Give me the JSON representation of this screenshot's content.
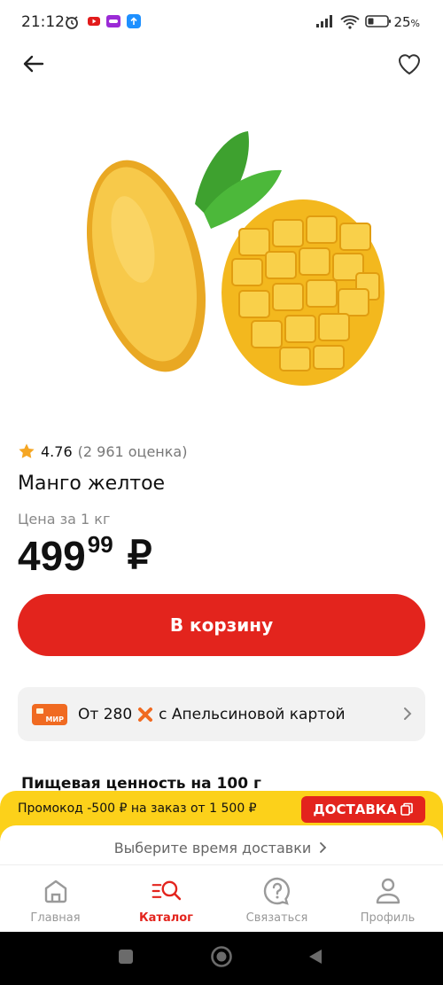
{
  "status_bar": {
    "time": "21:12",
    "battery": "25",
    "battery_unit": "%"
  },
  "product": {
    "rating": "4.76",
    "rating_count": "(2 961 оценка)",
    "title": "Манго желтое",
    "price_label": "Цена за 1 кг",
    "price_main": "499",
    "price_cents": "99",
    "currency": "₽"
  },
  "cart_button": {
    "label": "В корзину"
  },
  "card_promo": {
    "card_label": "МИР",
    "price": "От 280",
    "text": "с Апельсиновой картой"
  },
  "nutrition": {
    "heading": "Пищевая ценность на 100 г"
  },
  "promo_banner": {
    "code_text": "Промокод -500 ₽ на заказ от 1 500 ₽",
    "delivery_label": "ДОСТАВКА",
    "delivery_time": "Выберите время доставки"
  },
  "bottom_nav": {
    "items": [
      {
        "label": "Главная",
        "icon": "home-icon"
      },
      {
        "label": "Каталог",
        "icon": "catalog-icon",
        "active": true
      },
      {
        "label": "Связаться",
        "icon": "help-icon"
      },
      {
        "label": "Профиль",
        "icon": "profile-icon"
      }
    ]
  },
  "colors": {
    "accent": "#e3241d",
    "banner": "#fcd11a",
    "star": "#f5a623"
  }
}
